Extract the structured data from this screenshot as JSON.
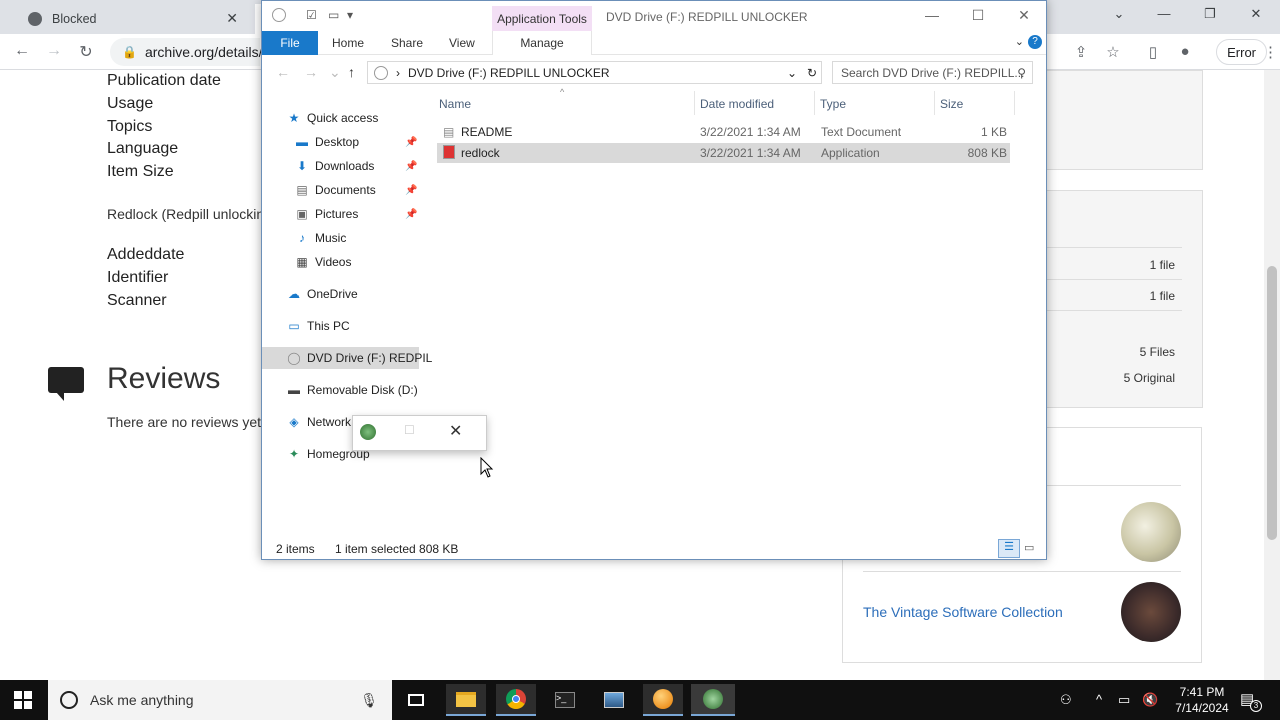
{
  "browser": {
    "tab_title": "Blocked",
    "tab_close": "✕",
    "url": "archive.org/details/",
    "error_label": "Error"
  },
  "page": {
    "meta_labels": [
      "Publication date",
      "Usage",
      "Topics",
      "Language",
      "Item Size"
    ],
    "description": "Redlock (Redpill unlockin",
    "meta_labels_2": [
      "Addeddate",
      "Identifier",
      "Scanner"
    ],
    "reviews_title": "Reviews",
    "no_reviews": "There are no reviews yet",
    "panel_values": [
      "1 file",
      "1 file",
      "5 Files",
      "5 Original"
    ],
    "collection_link": "The Vintage Software Collection"
  },
  "explorer": {
    "app_tools": "Application Tools",
    "window_title": "DVD Drive (F:) REDPILL UNLOCKER",
    "ribbon": {
      "file": "File",
      "home": "Home",
      "share": "Share",
      "view": "View",
      "manage": "Manage"
    },
    "address": "DVD Drive (F:) REDPILL UNLOCKER",
    "search_placeholder": "Search DVD Drive (F:) REDPILL...",
    "nav": {
      "quick_access": "Quick access",
      "desktop": "Desktop",
      "downloads": "Downloads",
      "documents": "Documents",
      "pictures": "Pictures",
      "music": "Music",
      "videos": "Videos",
      "onedrive": "OneDrive",
      "this_pc": "This PC",
      "dvd": "DVD Drive (F:) REDPIL",
      "removable": "Removable Disk (D:)",
      "network": "Network",
      "homegroup": "Homegroup"
    },
    "columns": {
      "name": "Name",
      "date": "Date modified",
      "type": "Type",
      "size": "Size"
    },
    "files": [
      {
        "name": "README",
        "date": "3/22/2021 1:34 AM",
        "type": "Text Document",
        "size": "1 KB"
      },
      {
        "name": "redlock",
        "date": "3/22/2021 1:34 AM",
        "type": "Application",
        "size": "808 KB"
      }
    ],
    "status": {
      "items": "2 items",
      "selected": "1 item selected  808 KB"
    }
  },
  "taskbar": {
    "search_placeholder": "Ask me anything",
    "time": "7:41 PM",
    "date": "7/14/2024",
    "notif_count": "3"
  },
  "colors": {
    "file_tab": "#1979ca",
    "app_tools_bg": "#f3dff5",
    "selected_row": "#d9d9d9",
    "taskbar": "#101010",
    "link": "#2c6eba"
  }
}
